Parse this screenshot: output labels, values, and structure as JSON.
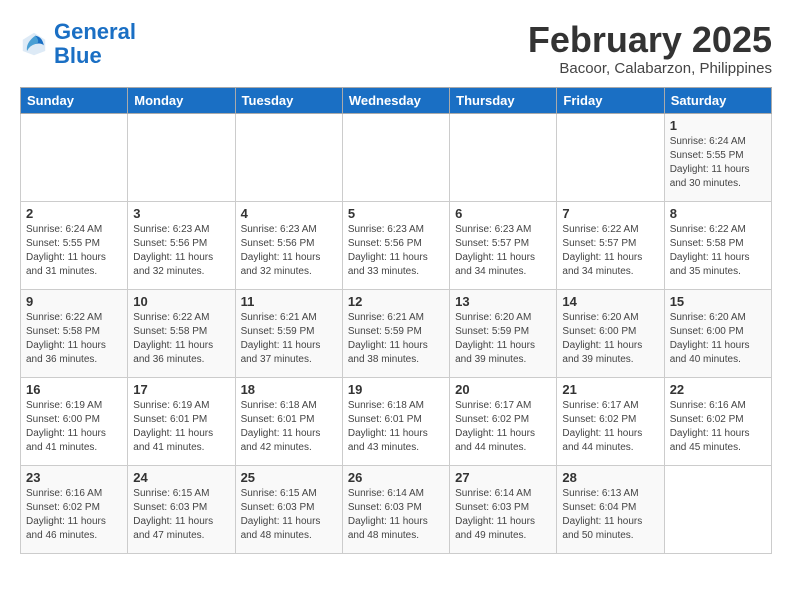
{
  "header": {
    "logo_line1": "General",
    "logo_line2": "Blue",
    "month_title": "February 2025",
    "subtitle": "Bacoor, Calabarzon, Philippines"
  },
  "days_of_week": [
    "Sunday",
    "Monday",
    "Tuesday",
    "Wednesday",
    "Thursday",
    "Friday",
    "Saturday"
  ],
  "weeks": [
    [
      {
        "day": "",
        "info": ""
      },
      {
        "day": "",
        "info": ""
      },
      {
        "day": "",
        "info": ""
      },
      {
        "day": "",
        "info": ""
      },
      {
        "day": "",
        "info": ""
      },
      {
        "day": "",
        "info": ""
      },
      {
        "day": "1",
        "info": "Sunrise: 6:24 AM\nSunset: 5:55 PM\nDaylight: 11 hours\nand 30 minutes."
      }
    ],
    [
      {
        "day": "2",
        "info": "Sunrise: 6:24 AM\nSunset: 5:55 PM\nDaylight: 11 hours\nand 31 minutes."
      },
      {
        "day": "3",
        "info": "Sunrise: 6:23 AM\nSunset: 5:56 PM\nDaylight: 11 hours\nand 32 minutes."
      },
      {
        "day": "4",
        "info": "Sunrise: 6:23 AM\nSunset: 5:56 PM\nDaylight: 11 hours\nand 32 minutes."
      },
      {
        "day": "5",
        "info": "Sunrise: 6:23 AM\nSunset: 5:56 PM\nDaylight: 11 hours\nand 33 minutes."
      },
      {
        "day": "6",
        "info": "Sunrise: 6:23 AM\nSunset: 5:57 PM\nDaylight: 11 hours\nand 34 minutes."
      },
      {
        "day": "7",
        "info": "Sunrise: 6:22 AM\nSunset: 5:57 PM\nDaylight: 11 hours\nand 34 minutes."
      },
      {
        "day": "8",
        "info": "Sunrise: 6:22 AM\nSunset: 5:58 PM\nDaylight: 11 hours\nand 35 minutes."
      }
    ],
    [
      {
        "day": "9",
        "info": "Sunrise: 6:22 AM\nSunset: 5:58 PM\nDaylight: 11 hours\nand 36 minutes."
      },
      {
        "day": "10",
        "info": "Sunrise: 6:22 AM\nSunset: 5:58 PM\nDaylight: 11 hours\nand 36 minutes."
      },
      {
        "day": "11",
        "info": "Sunrise: 6:21 AM\nSunset: 5:59 PM\nDaylight: 11 hours\nand 37 minutes."
      },
      {
        "day": "12",
        "info": "Sunrise: 6:21 AM\nSunset: 5:59 PM\nDaylight: 11 hours\nand 38 minutes."
      },
      {
        "day": "13",
        "info": "Sunrise: 6:20 AM\nSunset: 5:59 PM\nDaylight: 11 hours\nand 39 minutes."
      },
      {
        "day": "14",
        "info": "Sunrise: 6:20 AM\nSunset: 6:00 PM\nDaylight: 11 hours\nand 39 minutes."
      },
      {
        "day": "15",
        "info": "Sunrise: 6:20 AM\nSunset: 6:00 PM\nDaylight: 11 hours\nand 40 minutes."
      }
    ],
    [
      {
        "day": "16",
        "info": "Sunrise: 6:19 AM\nSunset: 6:00 PM\nDaylight: 11 hours\nand 41 minutes."
      },
      {
        "day": "17",
        "info": "Sunrise: 6:19 AM\nSunset: 6:01 PM\nDaylight: 11 hours\nand 41 minutes."
      },
      {
        "day": "18",
        "info": "Sunrise: 6:18 AM\nSunset: 6:01 PM\nDaylight: 11 hours\nand 42 minutes."
      },
      {
        "day": "19",
        "info": "Sunrise: 6:18 AM\nSunset: 6:01 PM\nDaylight: 11 hours\nand 43 minutes."
      },
      {
        "day": "20",
        "info": "Sunrise: 6:17 AM\nSunset: 6:02 PM\nDaylight: 11 hours\nand 44 minutes."
      },
      {
        "day": "21",
        "info": "Sunrise: 6:17 AM\nSunset: 6:02 PM\nDaylight: 11 hours\nand 44 minutes."
      },
      {
        "day": "22",
        "info": "Sunrise: 6:16 AM\nSunset: 6:02 PM\nDaylight: 11 hours\nand 45 minutes."
      }
    ],
    [
      {
        "day": "23",
        "info": "Sunrise: 6:16 AM\nSunset: 6:02 PM\nDaylight: 11 hours\nand 46 minutes."
      },
      {
        "day": "24",
        "info": "Sunrise: 6:15 AM\nSunset: 6:03 PM\nDaylight: 11 hours\nand 47 minutes."
      },
      {
        "day": "25",
        "info": "Sunrise: 6:15 AM\nSunset: 6:03 PM\nDaylight: 11 hours\nand 48 minutes."
      },
      {
        "day": "26",
        "info": "Sunrise: 6:14 AM\nSunset: 6:03 PM\nDaylight: 11 hours\nand 48 minutes."
      },
      {
        "day": "27",
        "info": "Sunrise: 6:14 AM\nSunset: 6:03 PM\nDaylight: 11 hours\nand 49 minutes."
      },
      {
        "day": "28",
        "info": "Sunrise: 6:13 AM\nSunset: 6:04 PM\nDaylight: 11 hours\nand 50 minutes."
      },
      {
        "day": "",
        "info": ""
      }
    ]
  ]
}
